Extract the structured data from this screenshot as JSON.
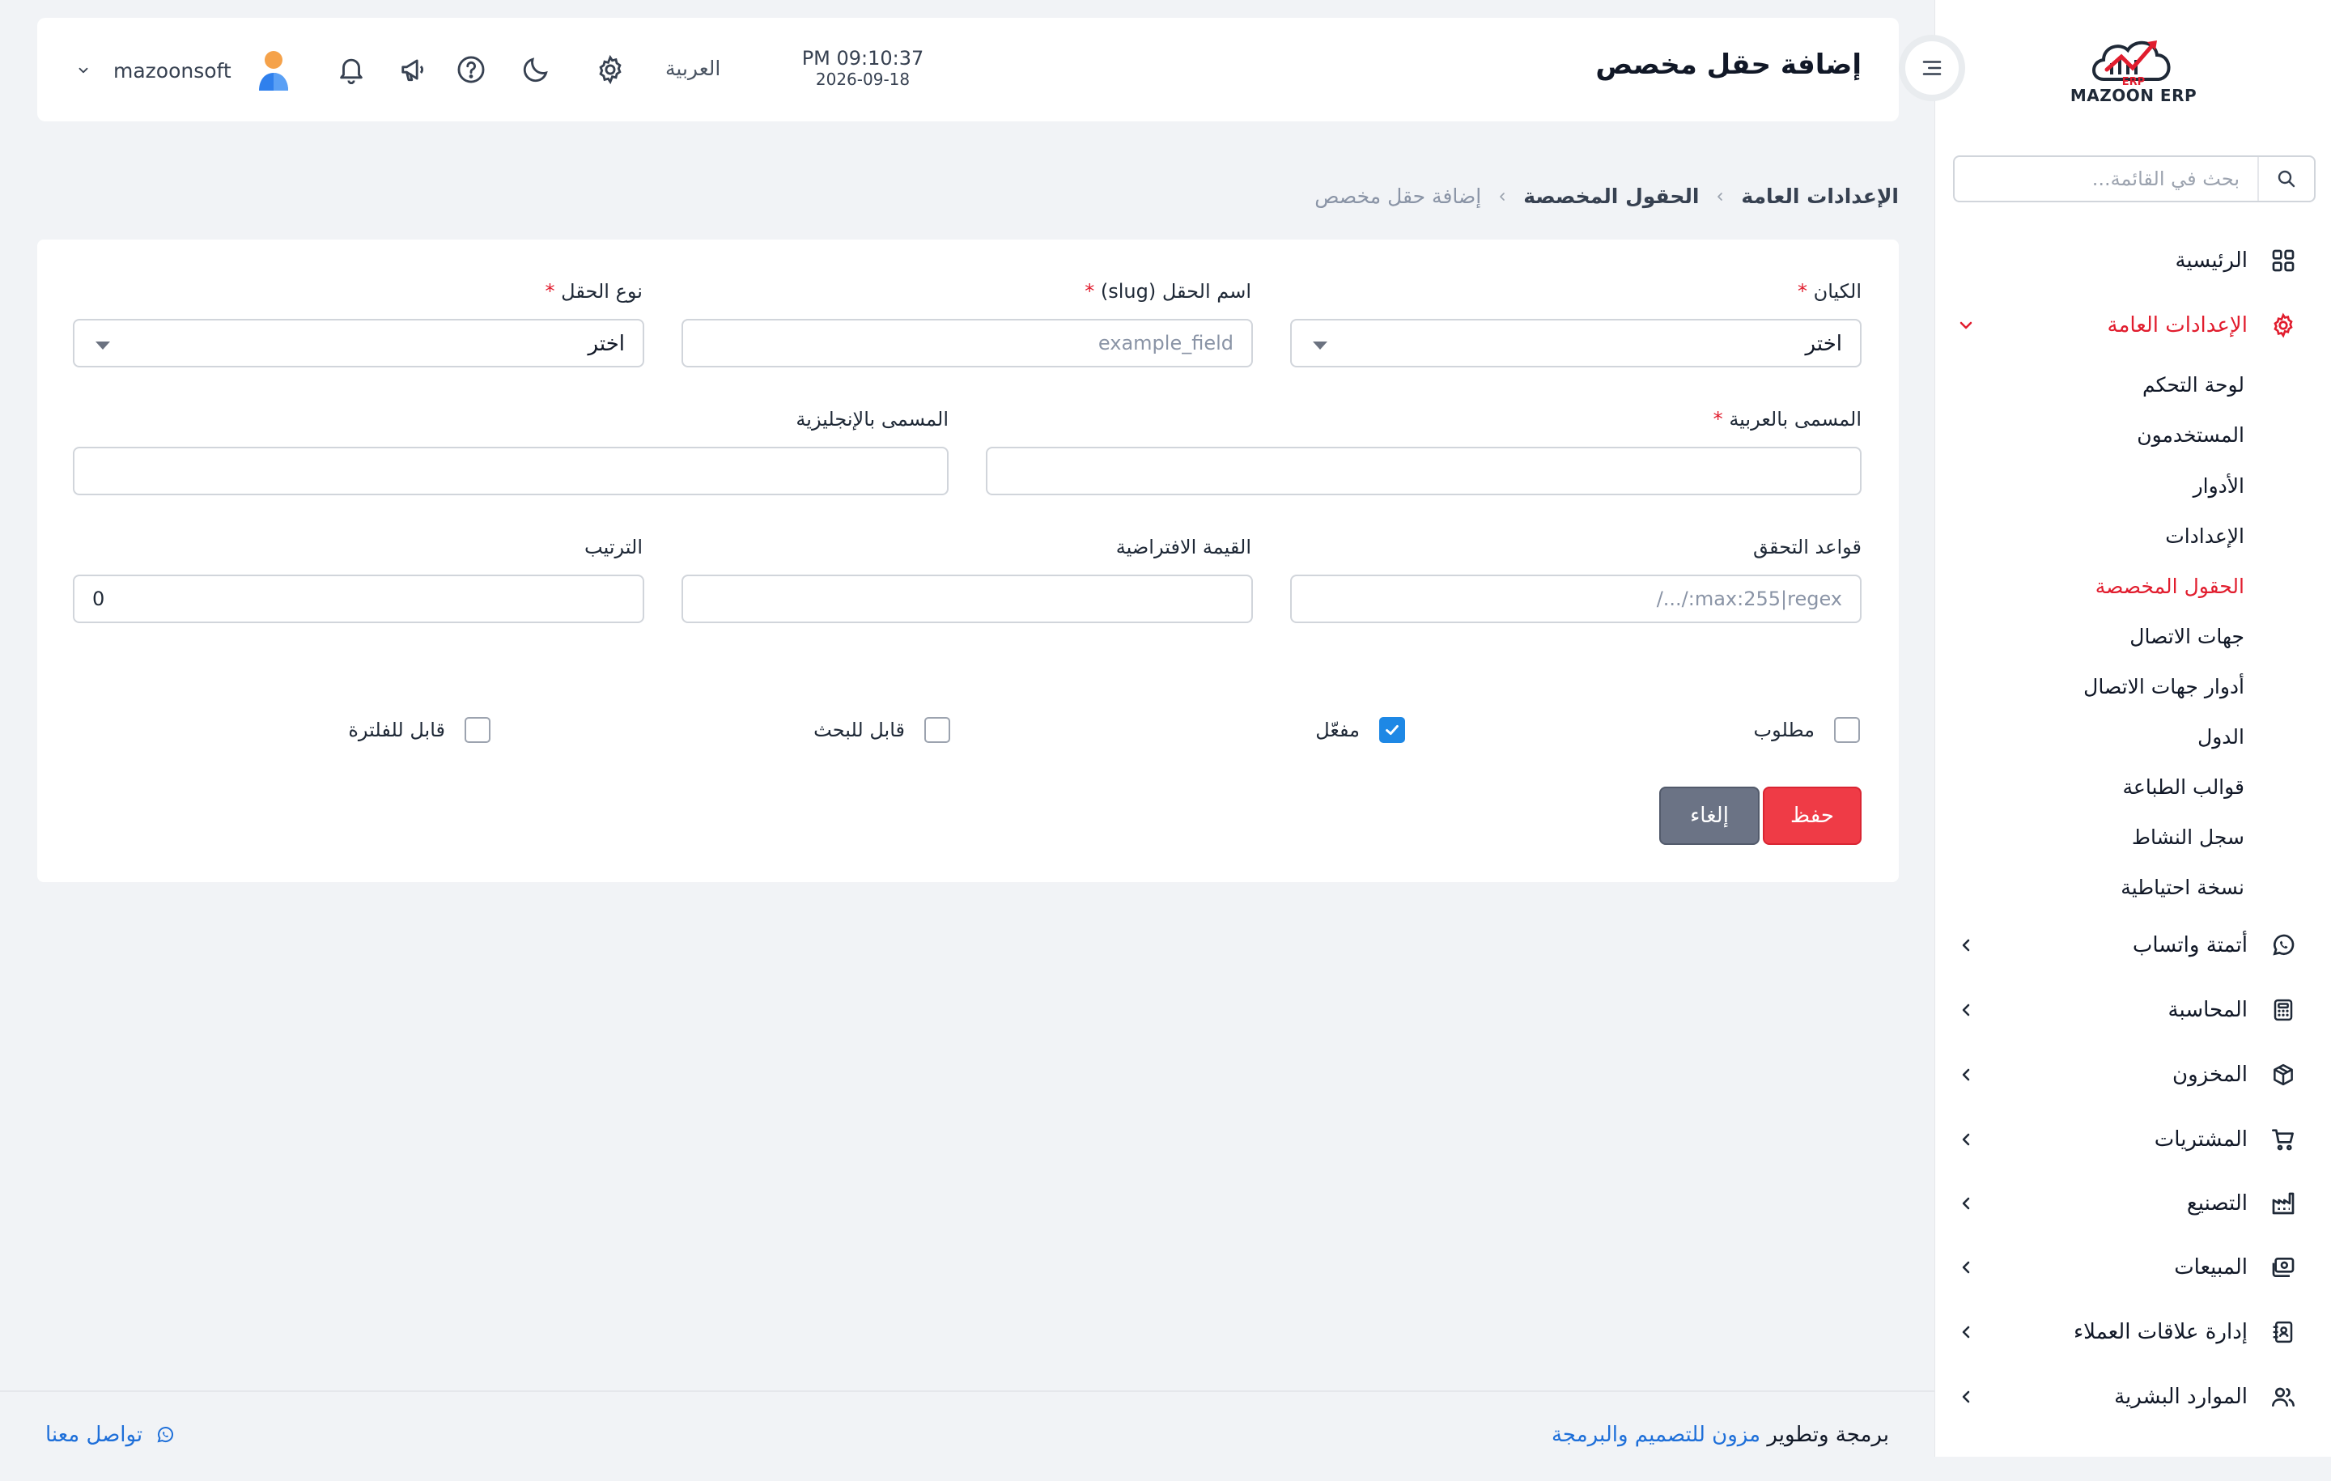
{
  "brand": {
    "name": "MAZOON ERP",
    "tag": "ERP"
  },
  "header": {
    "title": "إضافة حقل مخصص",
    "time": "PM 09:10:37",
    "date": "2026-09-18",
    "language": "العربية",
    "username": "mazoonsoft"
  },
  "sidebar": {
    "search_placeholder": "بحث في القائمة...",
    "items": [
      {
        "label": "الرئيسية",
        "icon": "grid-icon"
      },
      {
        "label": "الإعدادات العامة",
        "icon": "gear-icon",
        "active": true,
        "expanded": true
      },
      {
        "label": "أتمتة واتساب",
        "icon": "whatsapp-icon"
      },
      {
        "label": "المحاسبة",
        "icon": "calculator-icon"
      },
      {
        "label": "المخزون",
        "icon": "box-icon"
      },
      {
        "label": "المشتريات",
        "icon": "cart-icon"
      },
      {
        "label": "التصنيع",
        "icon": "factory-icon"
      },
      {
        "label": "المبيعات",
        "icon": "cash-icon"
      },
      {
        "label": "إدارة علاقات العملاء",
        "icon": "contacts-book-icon"
      },
      {
        "label": "الموارد البشرية",
        "icon": "users-icon"
      }
    ],
    "subitems": [
      {
        "label": "لوحة التحكم"
      },
      {
        "label": "المستخدمون"
      },
      {
        "label": "الأدوار"
      },
      {
        "label": "الإعدادات"
      },
      {
        "label": "الحقول المخصصة",
        "active": true
      },
      {
        "label": "جهات الاتصال"
      },
      {
        "label": "أدوار جهات الاتصال"
      },
      {
        "label": "الدول"
      },
      {
        "label": "قوالب الطباعة"
      },
      {
        "label": "سجل النشاط"
      },
      {
        "label": "نسخة احتياطية"
      }
    ]
  },
  "breadcrumb": {
    "root": "الإعدادات العامة",
    "parent": "الحقول المخصصة",
    "current": "إضافة حقل مخصص"
  },
  "form": {
    "entity": {
      "label": "الكيان",
      "value": "اختر"
    },
    "slug": {
      "label": "اسم الحقل (slug)",
      "placeholder": "example_field",
      "value": ""
    },
    "type": {
      "label": "نوع الحقل",
      "value": "اختر"
    },
    "name_ar": {
      "label": "المسمى بالعربية",
      "value": ""
    },
    "name_en": {
      "label": "المسمى بالإنجليزية",
      "value": ""
    },
    "validation": {
      "label": "قواعد التحقق",
      "placeholder": "max:255|regex:/.../",
      "value": ""
    },
    "default_value": {
      "label": "القيمة الافتراضية",
      "value": ""
    },
    "order": {
      "label": "الترتيب",
      "value": "0"
    },
    "checks": {
      "required": {
        "label": "مطلوب",
        "checked": false
      },
      "enabled": {
        "label": "مفعّل",
        "checked": true
      },
      "searchable": {
        "label": "قابل للبحث",
        "checked": false
      },
      "filterable": {
        "label": "قابل للفلترة",
        "checked": false
      }
    },
    "save_label": "حفظ",
    "cancel_label": "إلغاء"
  },
  "footer": {
    "credit_prefix": "برمجة وتطوير",
    "credit_link": "مزون للتصميم والبرمجة",
    "contact": "تواصل معنا"
  },
  "colors": {
    "accent": "#e11d2e",
    "primary_blue": "#1e88e5",
    "link": "#1e6fd9",
    "cancel": "#6b7385",
    "save": "#ef3b46"
  }
}
